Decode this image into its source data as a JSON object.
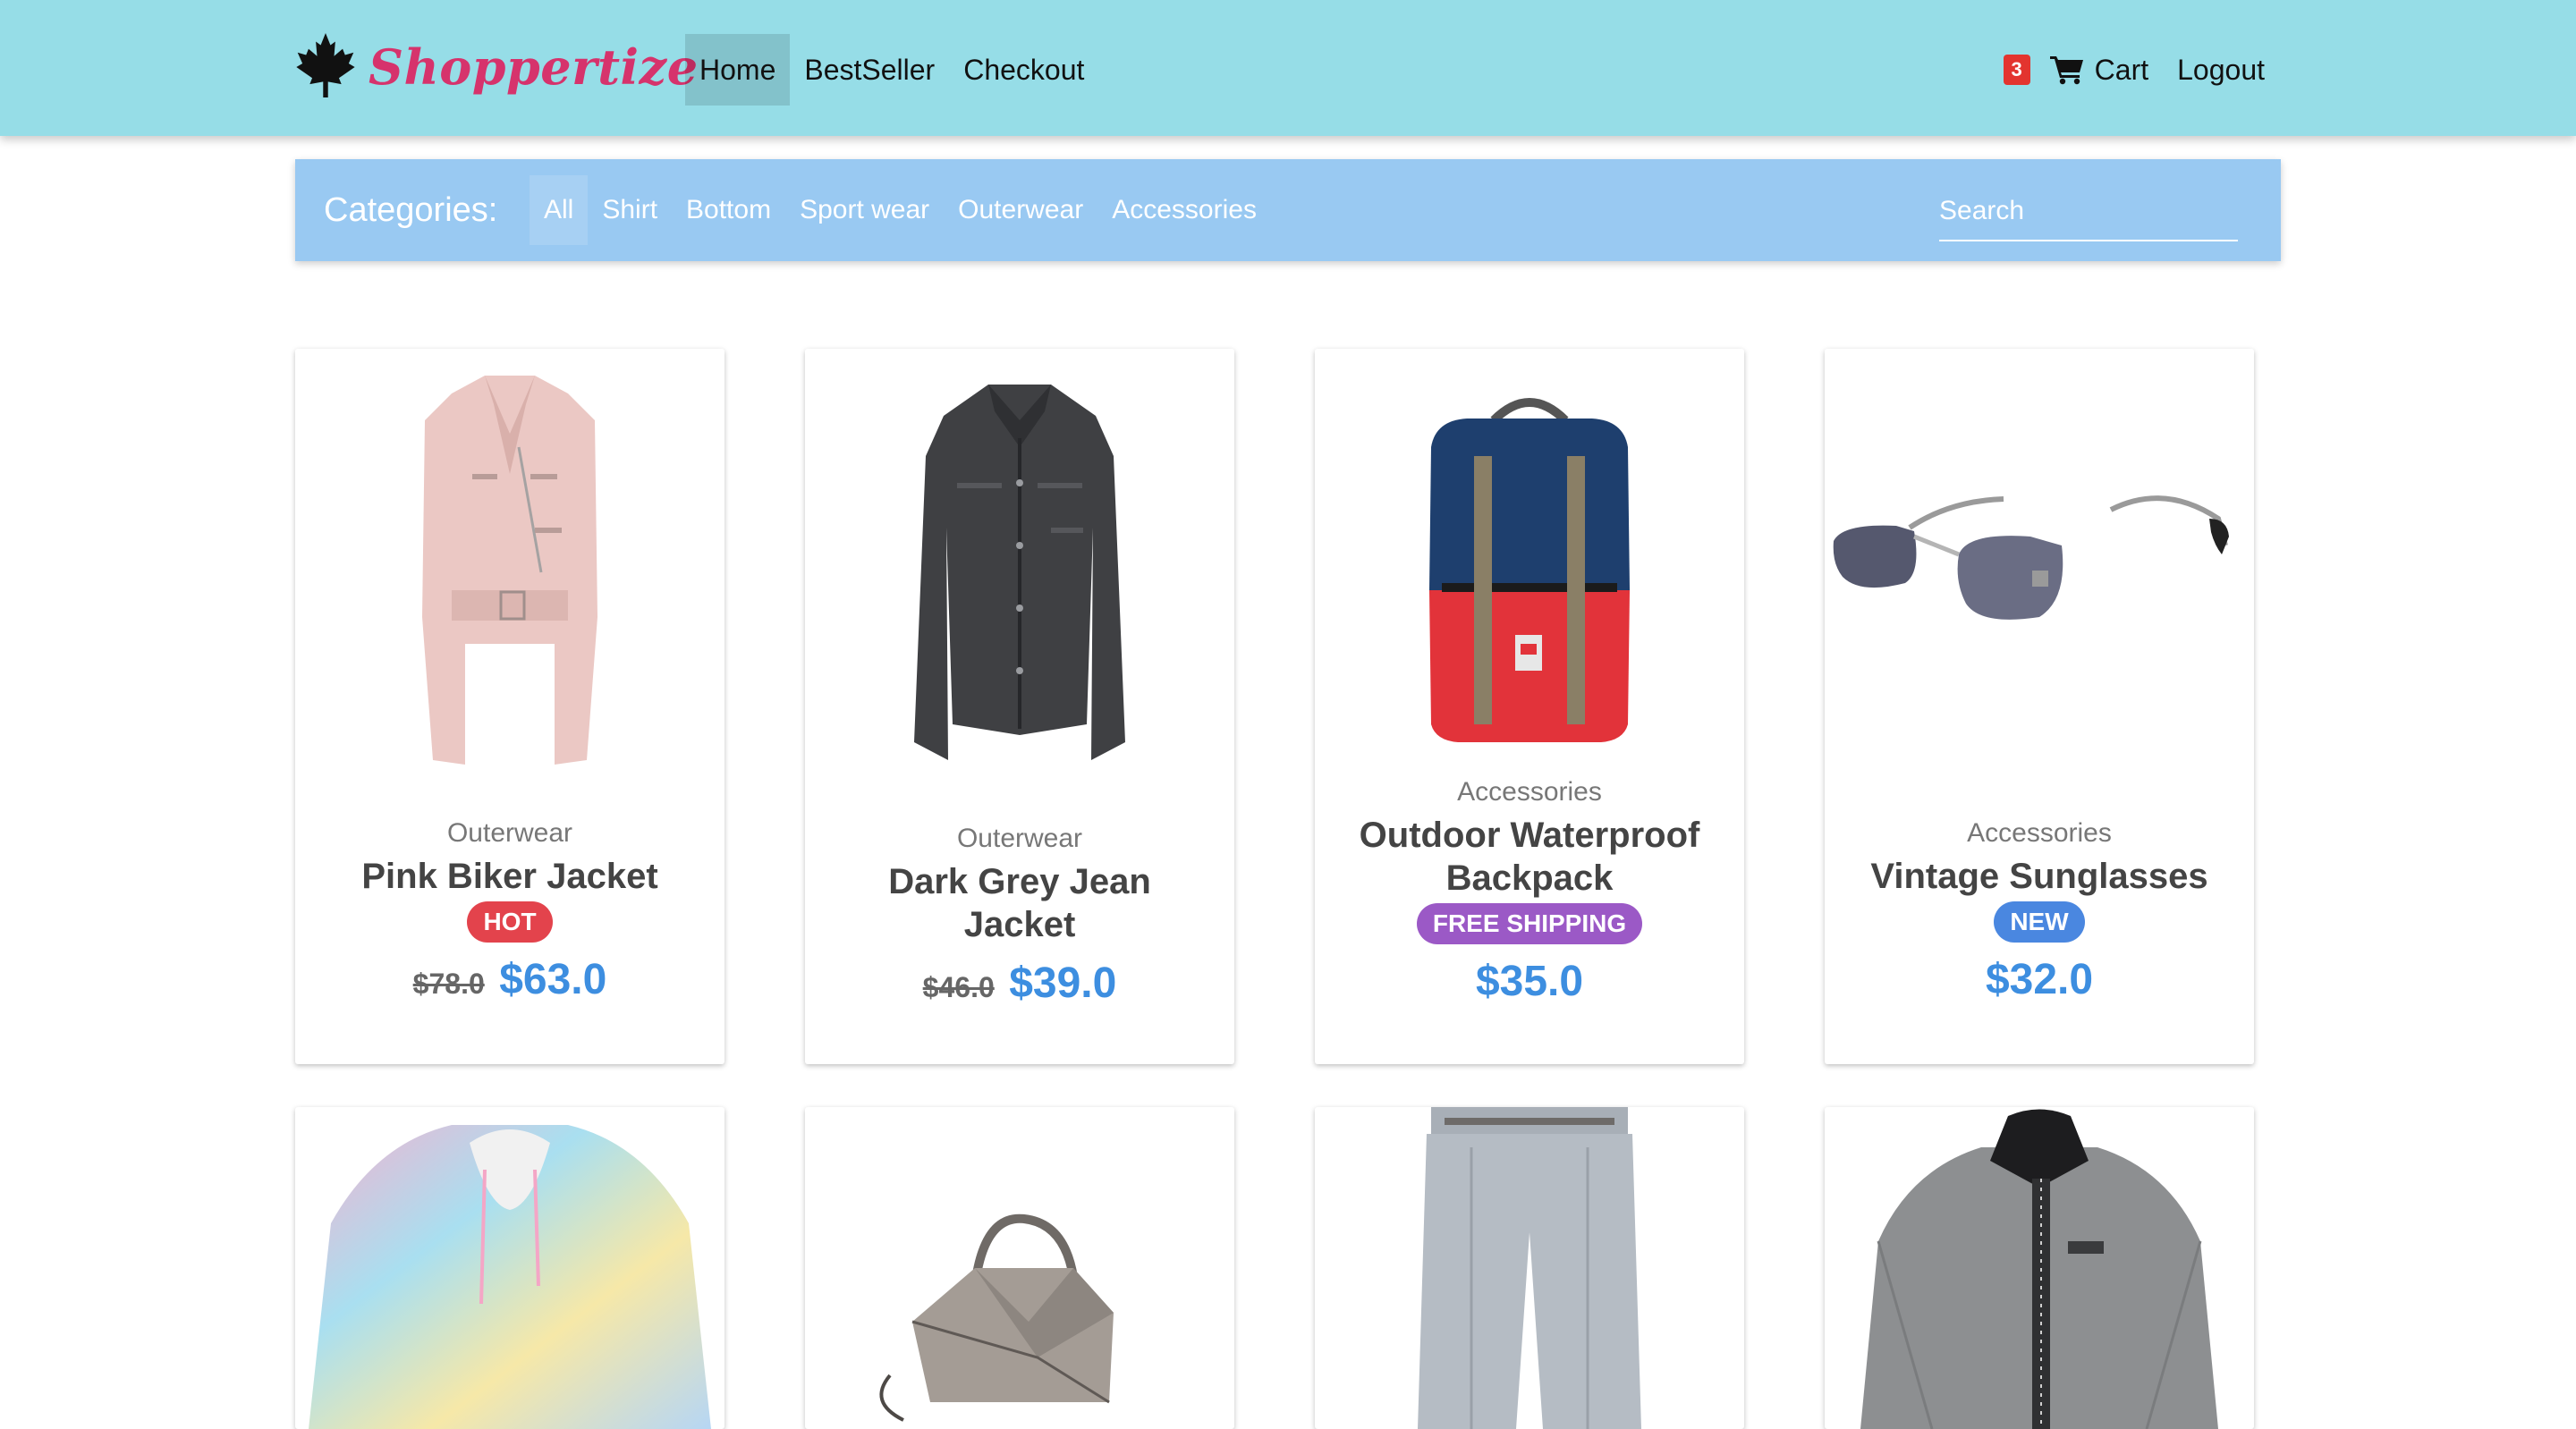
{
  "app": {
    "brand": "Shoppertize",
    "logo_icon": "maple-leaf-icon"
  },
  "nav": {
    "links": [
      {
        "label": "Home",
        "active": true
      },
      {
        "label": "BestSeller",
        "active": false
      },
      {
        "label": "Checkout",
        "active": false
      }
    ],
    "cart_count": "3",
    "cart_label": "Cart",
    "cart_icon": "shopping-cart-icon",
    "logout_label": "Logout"
  },
  "categories": {
    "title": "Categories:",
    "items": [
      {
        "label": "All",
        "active": true
      },
      {
        "label": "Shirt",
        "active": false
      },
      {
        "label": "Bottom",
        "active": false
      },
      {
        "label": "Sport wear",
        "active": false
      },
      {
        "label": "Outerwear",
        "active": false
      },
      {
        "label": "Accessories",
        "active": false
      }
    ],
    "search_placeholder": "Search"
  },
  "colors": {
    "navbar": "#96dde7",
    "category_bar": "#99c9f2",
    "brand": "#d6336c",
    "price": "#3d8ee0",
    "badge_hot": "#e3434c",
    "badge_shipping": "#9b59c6",
    "badge_new": "#4a87e0",
    "cart_badge": "#e3342f"
  },
  "products": [
    {
      "category": "Outerwear",
      "name": "Pink Biker Jacket",
      "badge": "HOT",
      "badge_color": "#e3434c",
      "old_price": "$78.0",
      "price": "$63.0",
      "image": "pink-biker-jacket-image"
    },
    {
      "category": "Outerwear",
      "name": "Dark Grey Jean Jacket",
      "badge": "",
      "old_price": "$46.0",
      "price": "$39.0",
      "image": "dark-grey-jean-jacket-image"
    },
    {
      "category": "Accessories",
      "name": "Outdoor Waterproof Backpack",
      "badge": "FREE SHIPPING",
      "badge_color": "#9b59c6",
      "old_price": "",
      "price": "$35.0",
      "image": "backpack-image"
    },
    {
      "category": "Accessories",
      "name": "Vintage Sunglasses",
      "badge": "NEW",
      "badge_color": "#4a87e0",
      "old_price": "",
      "price": "$32.0",
      "image": "sunglasses-image"
    },
    {
      "image": "tie-dye-hoodie-image"
    },
    {
      "image": "leather-handbag-image"
    },
    {
      "image": "grey-trousers-image"
    },
    {
      "image": "grey-jacket-image"
    }
  ]
}
